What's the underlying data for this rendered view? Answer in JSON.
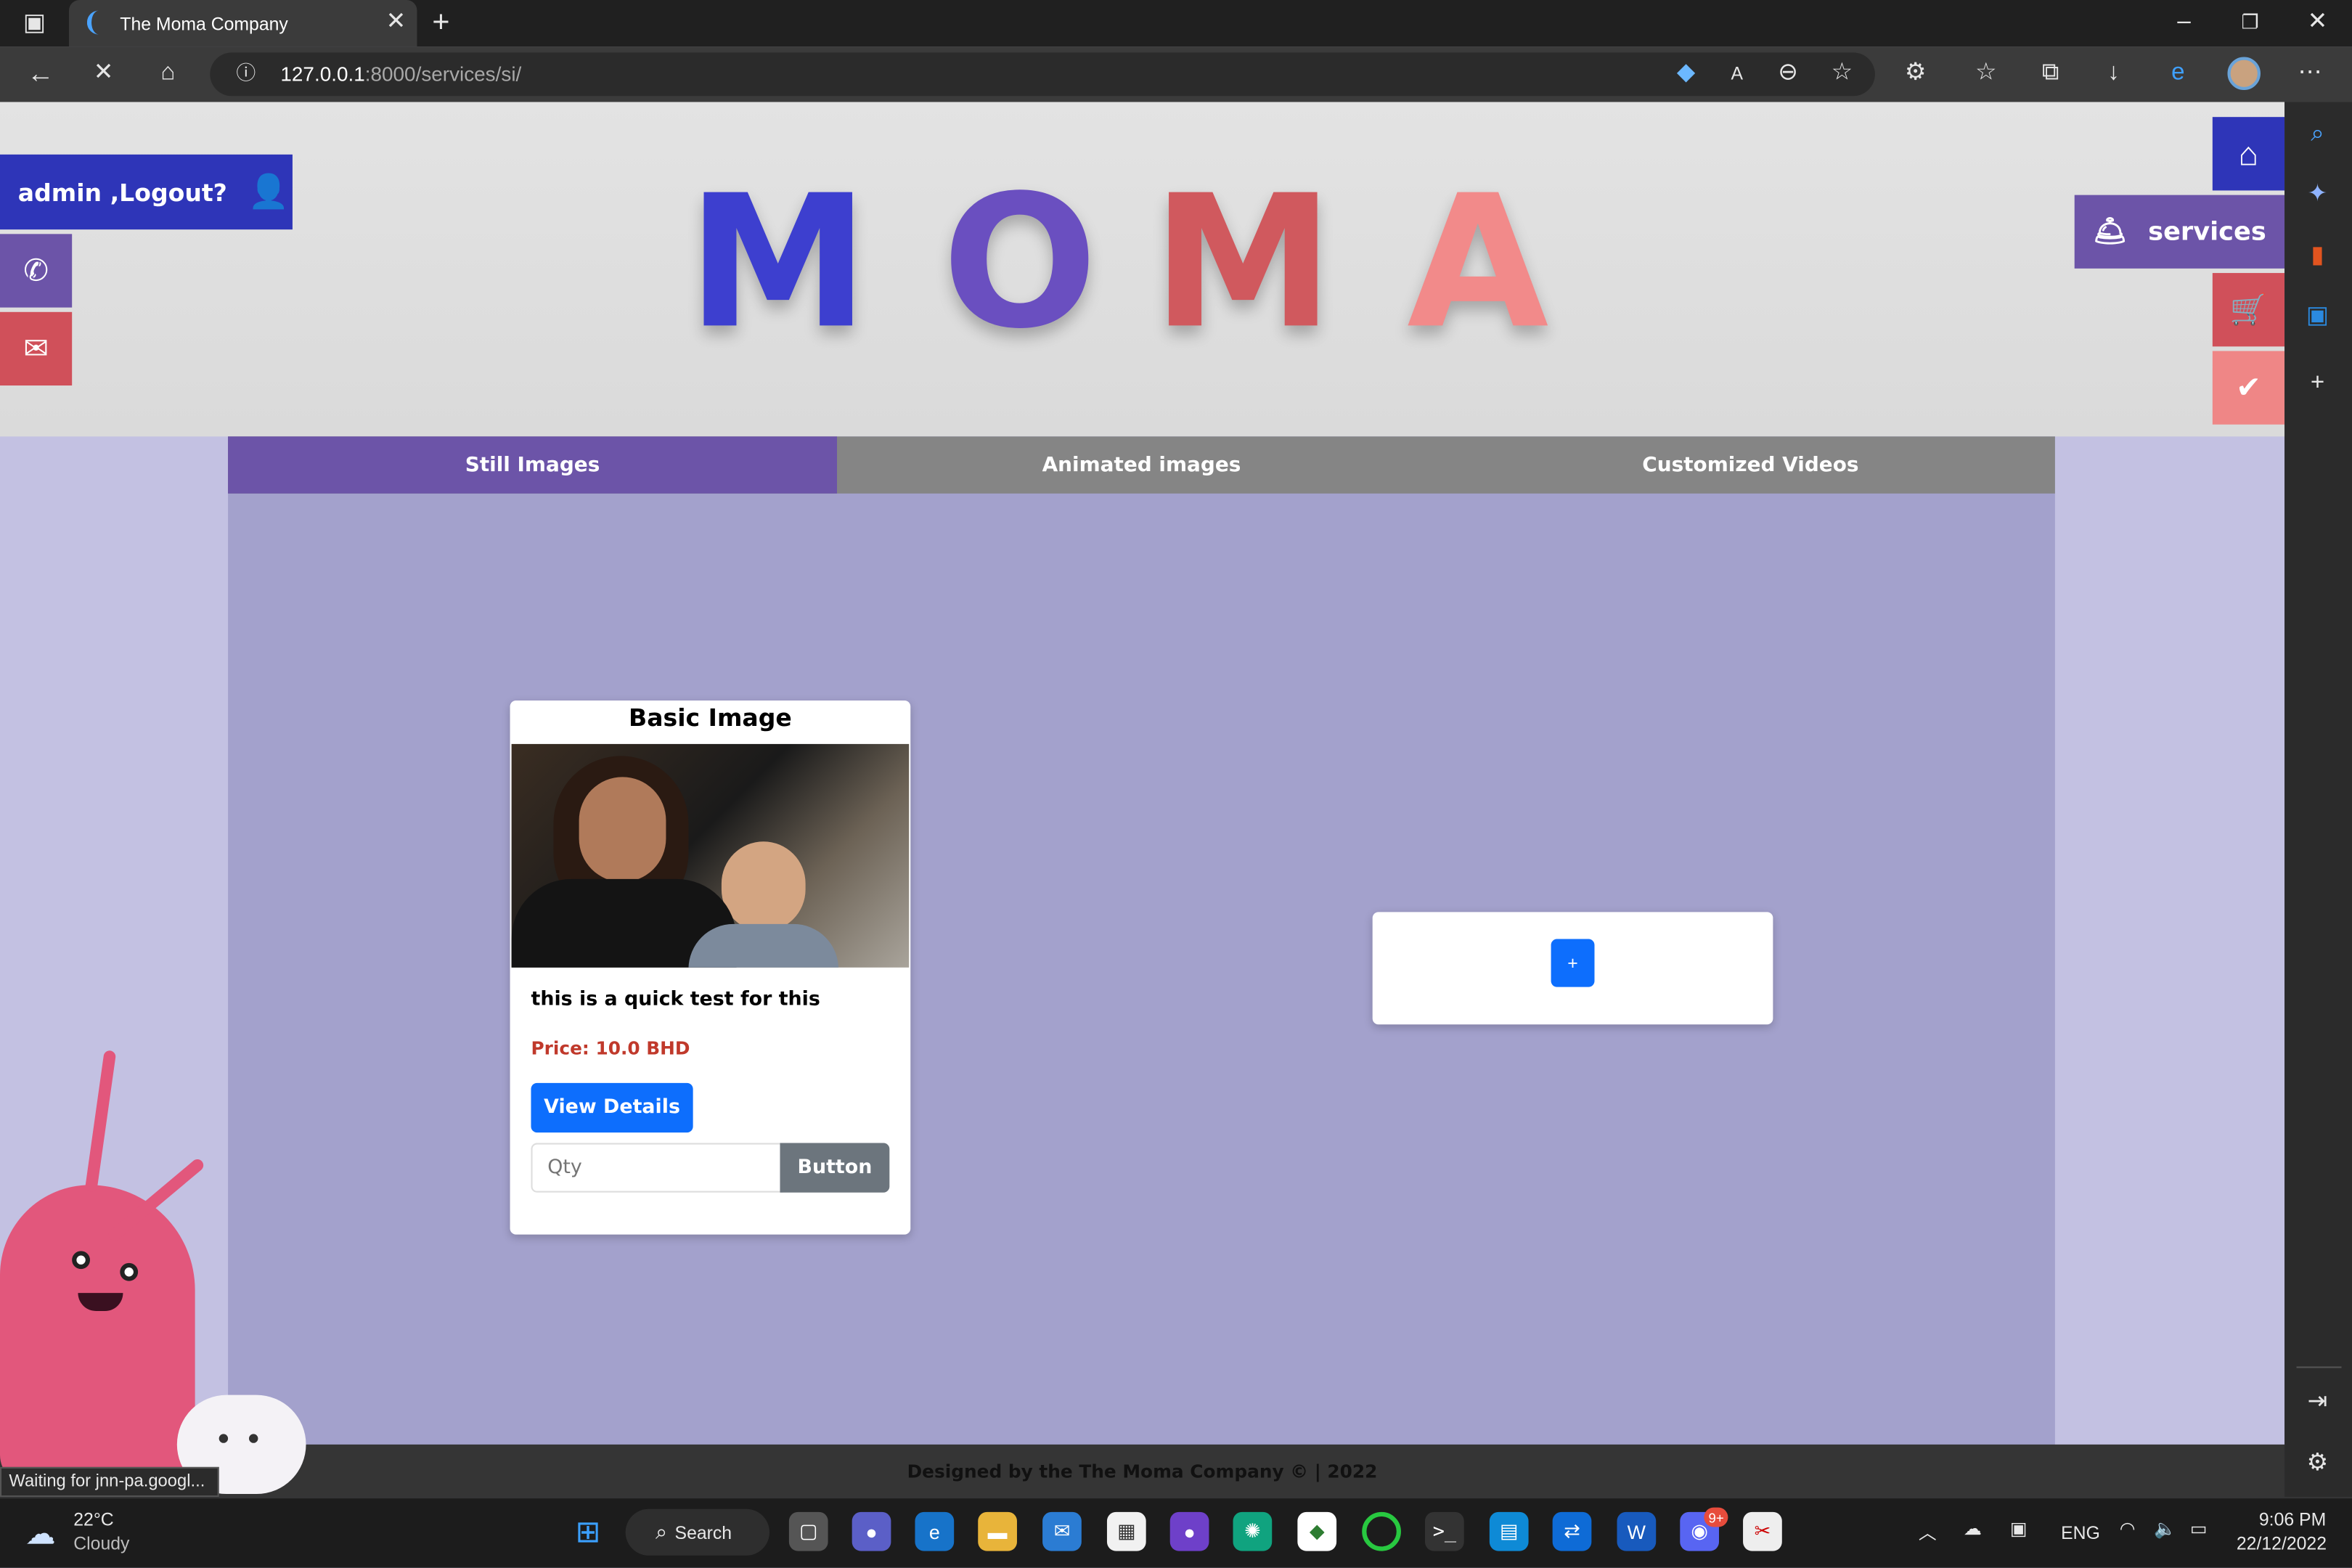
{
  "browser": {
    "tab_title": "The Moma Company",
    "url_host": "127.0.0.1",
    "url_path": ":8000/services/si/",
    "status_text": "Waiting for jnn-pa.googl..."
  },
  "icons": {
    "tab_actions": "tab-actions-icon",
    "close_tab": "close-icon",
    "new_tab": "plus-icon",
    "back": "back-arrow-icon",
    "stop": "stop-icon",
    "home": "home-icon",
    "info": "info-icon"
  },
  "header": {
    "user_label": "admin ,Logout?",
    "logo_letters": [
      "M",
      "O",
      "M",
      "A"
    ],
    "logo_colors": [
      "#3d3fcf",
      "#6a4fc0",
      "#d0595e",
      "#f28a8a"
    ]
  },
  "side_nav": {
    "services_label": "services"
  },
  "tabs": [
    {
      "label": "Still Images",
      "active": true
    },
    {
      "label": "Animated images",
      "active": false
    },
    {
      "label": "Customized Videos",
      "active": false
    }
  ],
  "card": {
    "title": "Basic Image",
    "description": "this is a quick test for this",
    "price": "Price: 10.0 BHD",
    "details_button": "View Details",
    "qty_placeholder": "Qty",
    "add_button": "Button"
  },
  "add_card": {
    "plus_label": "+"
  },
  "footer": {
    "text": "Designed by the The Moma Company © | 2022"
  },
  "taskbar": {
    "weather_temp": "22°C",
    "weather_desc": "Cloudy",
    "search_label": "Search",
    "lang": "ENG",
    "time": "9:06 PM",
    "date": "22/12/2022",
    "discord_badge": "9+"
  },
  "colors": {
    "brand_blue": "#2e35b8",
    "brand_purple": "#6c54a8",
    "brand_red": "#d0505a",
    "brand_pink": "#ef8686",
    "primary_button": "#0d6efd",
    "secondary_button": "#6c757d",
    "price_red": "#c0392b"
  }
}
